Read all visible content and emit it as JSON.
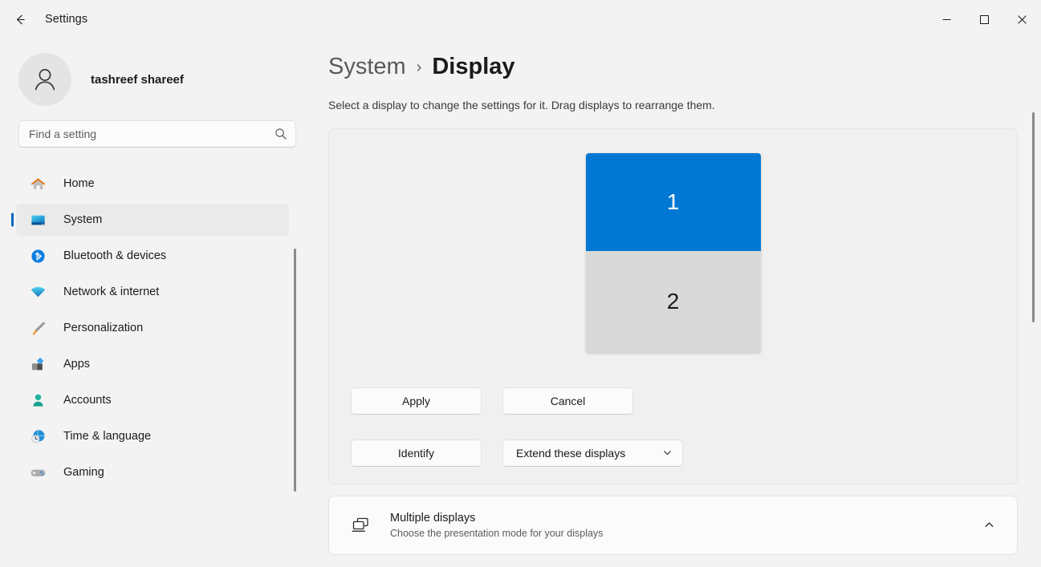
{
  "titlebar": {
    "app_title": "Settings",
    "back_icon": "arrow-left-icon",
    "minimize_label": "—",
    "maximize_label": "☐",
    "close_label": "✕"
  },
  "sidebar": {
    "account": {
      "name": "tashreef shareef",
      "avatar_icon": "person-icon"
    },
    "search": {
      "placeholder": "Find a setting",
      "value": "",
      "icon": "search-icon"
    },
    "items": [
      {
        "label": "Home",
        "icon": "home-icon",
        "selected": false
      },
      {
        "label": "System",
        "icon": "monitor-icon",
        "selected": true
      },
      {
        "label": "Bluetooth & devices",
        "icon": "bluetooth-icon",
        "selected": false
      },
      {
        "label": "Network & internet",
        "icon": "wifi-icon",
        "selected": false
      },
      {
        "label": "Personalization",
        "icon": "paintbrush-icon",
        "selected": false
      },
      {
        "label": "Apps",
        "icon": "apps-icon",
        "selected": false
      },
      {
        "label": "Accounts",
        "icon": "account-icon",
        "selected": false
      },
      {
        "label": "Time & language",
        "icon": "clock-globe-icon",
        "selected": false
      },
      {
        "label": "Gaming",
        "icon": "gamepad-icon",
        "selected": false
      }
    ]
  },
  "main": {
    "breadcrumb": {
      "parent": "System",
      "separator": "›",
      "current": "Display"
    },
    "description": "Select a display to change the settings for it. Drag displays to rearrange them.",
    "display_arrangement": {
      "monitors": [
        {
          "number": "1",
          "selected": true,
          "color": "#0078D4"
        },
        {
          "number": "2",
          "selected": false,
          "color": "#D9D9D9"
        }
      ],
      "buttons": {
        "apply": "Apply",
        "cancel": "Cancel",
        "identify": "Identify"
      },
      "display_mode": {
        "value": "Extend these displays",
        "chevron_icon": "chevron-down-icon"
      }
    },
    "multiple_displays": {
      "title": "Multiple displays",
      "subtitle": "Choose the presentation mode for your displays",
      "icon": "multiple-monitors-icon",
      "chevron_icon": "chevron-up-icon"
    }
  },
  "colors": {
    "accent": "#0067C0",
    "selected_monitor": "#0078D4",
    "page_background": "#F3F3F3",
    "card_background": "#F0F0F0"
  }
}
